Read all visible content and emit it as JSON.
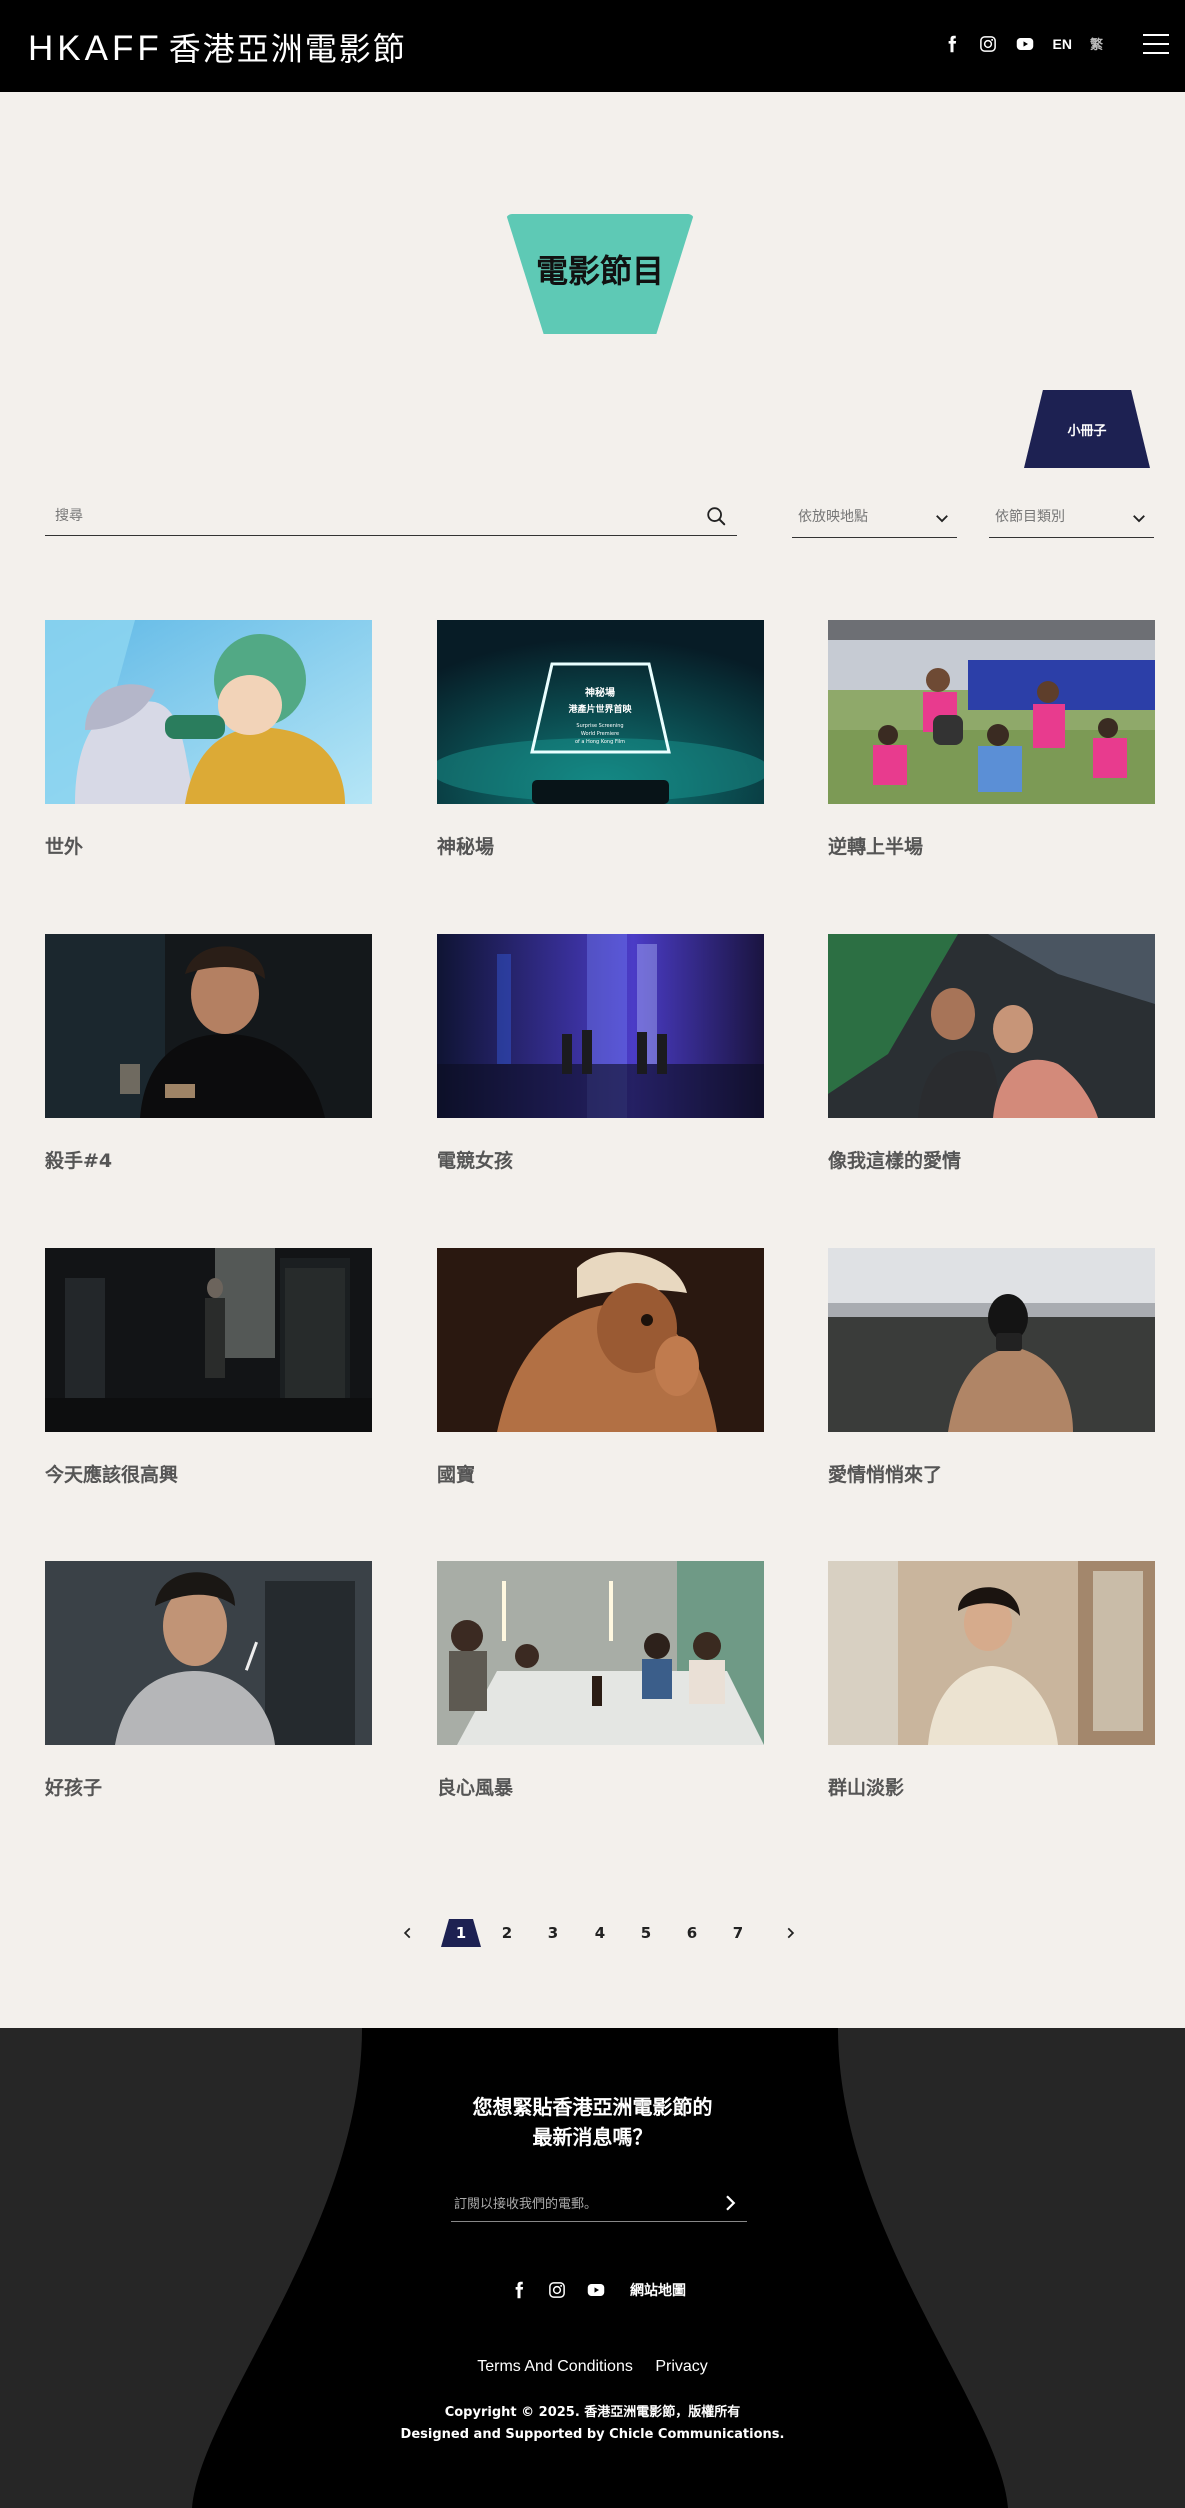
{
  "header": {
    "logo_latin": "HKAFF",
    "logo_cjk": "香港亞洲電影節",
    "lang_en": "EN",
    "lang_zh": "繁"
  },
  "page": {
    "title": "電影節目",
    "booklet": "小冊子"
  },
  "filters": {
    "search_placeholder": "搜尋",
    "venue": "依放映地點",
    "category": "依節目類別"
  },
  "films": [
    {
      "title": "世外"
    },
    {
      "title": "神秘場",
      "overlay_title": "神秘場",
      "overlay_subtitle": "港產片世界首映",
      "overlay_en1": "Surprise Screening",
      "overlay_en2": "World Premiere",
      "overlay_en3": "of a Hong Kong Film"
    },
    {
      "title": "逆轉上半場"
    },
    {
      "title": "殺手#4"
    },
    {
      "title": "電競女孩"
    },
    {
      "title": "像我這樣的愛情"
    },
    {
      "title": "今天應該很高興"
    },
    {
      "title": "國寶"
    },
    {
      "title": "愛情悄悄來了"
    },
    {
      "title": "好孩子"
    },
    {
      "title": "良心風暴"
    },
    {
      "title": "群山淡影"
    }
  ],
  "pagination": {
    "pages": [
      "1",
      "2",
      "3",
      "4",
      "5",
      "6",
      "7"
    ],
    "current": "1"
  },
  "footer": {
    "title_line1": "您想緊貼香港亞洲電影節的",
    "title_line2": "最新消息嗎？",
    "newsletter_placeholder": "訂閱以接收我們的電郵。",
    "sitemap": "網站地圖",
    "terms": "Terms And Conditions",
    "privacy": "Privacy",
    "copyright": "Copyright © 2025. 香港亞洲電影節，版權所有",
    "credit": "Designed and Supported by Chicle Communications."
  },
  "colors": {
    "header_bg": "#000000",
    "page_bg": "#f3f0ec",
    "title_accent": "#5ec9b5",
    "navy": "#1d2152",
    "footer_bg": "#262626"
  }
}
